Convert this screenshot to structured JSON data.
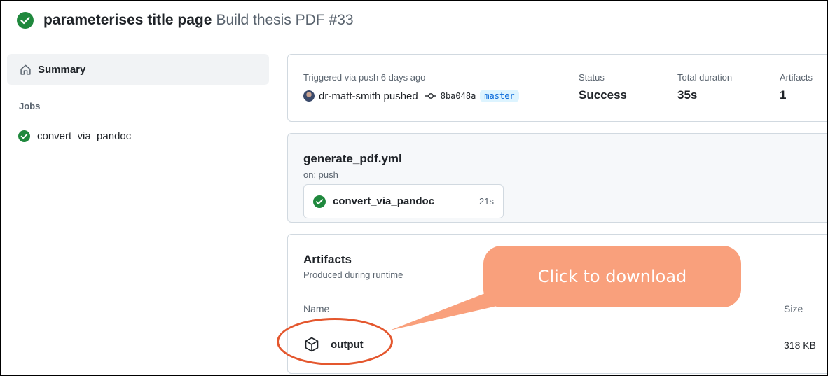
{
  "header": {
    "commit_title": "parameterises title page",
    "workflow_run": "Build thesis PDF #33"
  },
  "sidebar": {
    "summary_label": "Summary",
    "jobs_heading": "Jobs",
    "jobs": [
      {
        "label": "convert_via_pandoc"
      }
    ]
  },
  "summary": {
    "triggered": "Triggered via push 6 days ago",
    "actor": "dr-matt-smith pushed",
    "commit_sha": "8ba048a",
    "branch": "master",
    "stats": [
      {
        "label": "Status",
        "value": "Success"
      },
      {
        "label": "Total duration",
        "value": "35s"
      },
      {
        "label": "Artifacts",
        "value": "1"
      }
    ]
  },
  "workflow": {
    "file": "generate_pdf.yml",
    "trigger": "on: push",
    "job": {
      "name": "convert_via_pandoc",
      "duration": "21s"
    }
  },
  "artifacts": {
    "title": "Artifacts",
    "subtitle": "Produced during runtime",
    "col_name": "Name",
    "col_size": "Size",
    "items": [
      {
        "name": "output",
        "size": "318 KB"
      }
    ]
  },
  "annotation": {
    "callout_text": "Click to download"
  },
  "colors": {
    "success": "#1f883d",
    "link": "#0969da",
    "callout": "#f9a07c",
    "highlight_ring": "#e4572e"
  },
  "icons": [
    "check-circle-icon",
    "home-icon",
    "commit-icon",
    "package-icon"
  ]
}
